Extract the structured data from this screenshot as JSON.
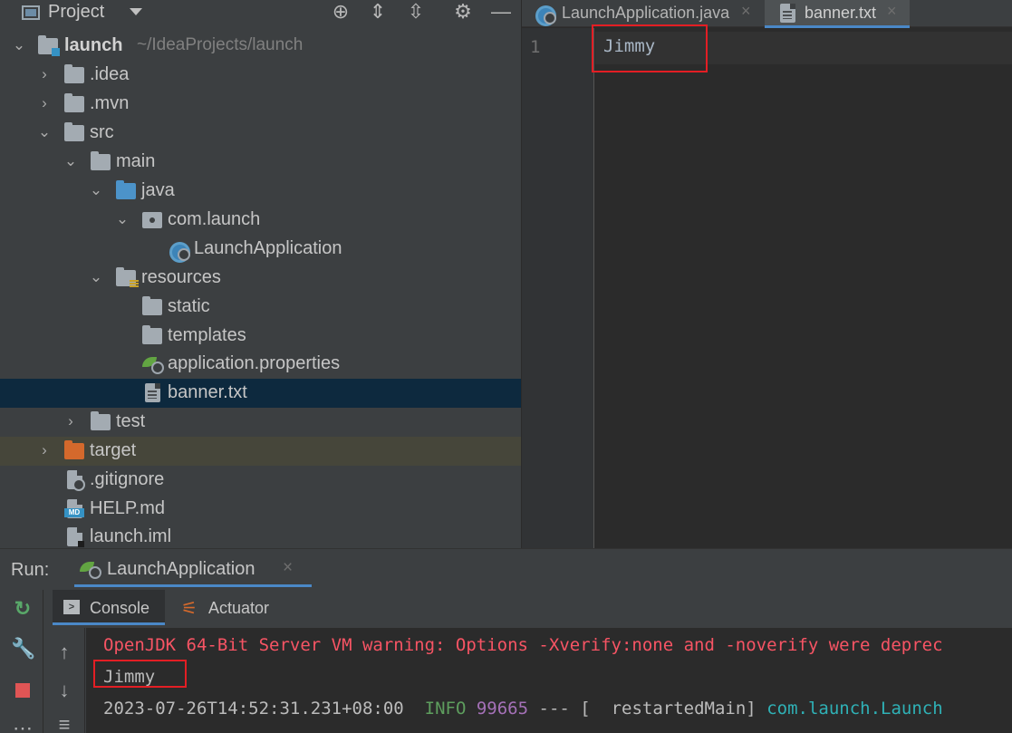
{
  "project_panel": {
    "title": "Project",
    "toolbar_icons": [
      "locate-icon",
      "expand-all-icon",
      "collapse-all-icon",
      "gear-icon",
      "minimize-icon"
    ],
    "tree": [
      {
        "label": "launch",
        "sub": "~/IdeaProjects/launch",
        "icon": "module-folder-icon",
        "expanded": true
      },
      {
        "label": ".idea",
        "icon": "folder-icon",
        "expanded": false
      },
      {
        "label": ".mvn",
        "icon": "folder-icon",
        "expanded": false
      },
      {
        "label": "src",
        "icon": "folder-icon",
        "expanded": true
      },
      {
        "label": "main",
        "icon": "folder-icon",
        "expanded": true
      },
      {
        "label": "java",
        "icon": "source-folder-icon",
        "expanded": true
      },
      {
        "label": "com.launch",
        "icon": "package-icon",
        "expanded": true
      },
      {
        "label": "LaunchApplication",
        "icon": "spring-boot-class-icon"
      },
      {
        "label": "resources",
        "icon": "resources-folder-icon",
        "expanded": true
      },
      {
        "label": "static",
        "icon": "folder-icon"
      },
      {
        "label": "templates",
        "icon": "folder-icon"
      },
      {
        "label": "application.properties",
        "icon": "spring-properties-icon"
      },
      {
        "label": "banner.txt",
        "icon": "text-file-icon",
        "selected": true
      },
      {
        "label": "test",
        "icon": "folder-icon",
        "expanded": false
      },
      {
        "label": "target",
        "icon": "excluded-folder-icon",
        "expanded": false
      },
      {
        "label": ".gitignore",
        "icon": "ignore-file-icon"
      },
      {
        "label": "HELP.md",
        "icon": "markdown-file-icon"
      },
      {
        "label": "launch.iml",
        "icon": "iml-file-icon"
      }
    ]
  },
  "editor": {
    "tabs": [
      {
        "label": "LaunchApplication.java",
        "icon": "spring-boot-class-icon",
        "active": false
      },
      {
        "label": "banner.txt",
        "icon": "text-file-icon",
        "active": true
      }
    ],
    "line_number": "1",
    "code": "Jimmy"
  },
  "run_panel": {
    "title": "Run:",
    "config_tab": "LaunchApplication",
    "sub_tabs": [
      "Console",
      "Actuator"
    ],
    "console_lines": [
      {
        "text": "OpenJDK 64-Bit Server VM warning: Options -Xverify:none and -noverify were deprec",
        "color": "#f75464"
      },
      {
        "text": "Jimmy",
        "color": "#bbbbbb"
      },
      {
        "timestamp": "2023-07-26T14:52:31.231+08:00",
        "level": "INFO",
        "pid": "99665",
        "sep": "--- [",
        "thread": "restartedMain]",
        "logger": "com.launch.Launch"
      }
    ]
  },
  "colors": {
    "accent": "#4a88c7",
    "highlight_box": "#e31e24",
    "selection": "#0d293e",
    "error_text": "#f75464",
    "info_level": "#5e9e5e",
    "pid": "#a571b8",
    "logger": "#2fb1b6"
  }
}
